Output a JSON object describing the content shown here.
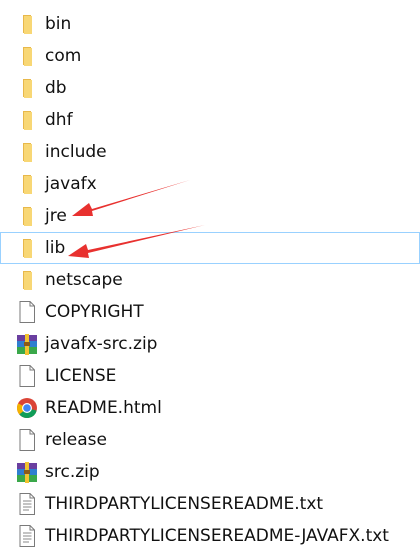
{
  "explorer": {
    "items": [
      {
        "name": "bin",
        "type": "folder",
        "icon": "folder-icon"
      },
      {
        "name": "com",
        "type": "folder",
        "icon": "folder-icon"
      },
      {
        "name": "db",
        "type": "folder",
        "icon": "folder-icon"
      },
      {
        "name": "dhf",
        "type": "folder",
        "icon": "folder-icon"
      },
      {
        "name": "include",
        "type": "folder",
        "icon": "folder-icon"
      },
      {
        "name": "javafx",
        "type": "folder",
        "icon": "folder-icon"
      },
      {
        "name": "jre",
        "type": "folder",
        "icon": "folder-icon"
      },
      {
        "name": "lib",
        "type": "folder",
        "icon": "folder-icon",
        "hovered": true
      },
      {
        "name": "netscape",
        "type": "folder",
        "icon": "folder-icon"
      },
      {
        "name": "COPYRIGHT",
        "type": "file",
        "icon": "file-icon"
      },
      {
        "name": "javafx-src.zip",
        "type": "archive",
        "icon": "winrar-archive-icon"
      },
      {
        "name": "LICENSE",
        "type": "file",
        "icon": "file-icon"
      },
      {
        "name": "README.html",
        "type": "html",
        "icon": "chrome-icon"
      },
      {
        "name": "release",
        "type": "file",
        "icon": "file-icon"
      },
      {
        "name": "src.zip",
        "type": "archive",
        "icon": "winrar-archive-icon"
      },
      {
        "name": "THIRDPARTYLICENSEREADME.txt",
        "type": "text",
        "icon": "text-file-icon"
      },
      {
        "name": "THIRDPARTYLICENSEREADME-JAVAFX.txt",
        "type": "text",
        "icon": "text-file-icon"
      }
    ]
  },
  "colors": {
    "folder_yellow": "#f8d775",
    "folder_dark": "#e8b84a",
    "hover_border": "#99d1ff",
    "arrow_red": "#e8312f"
  }
}
